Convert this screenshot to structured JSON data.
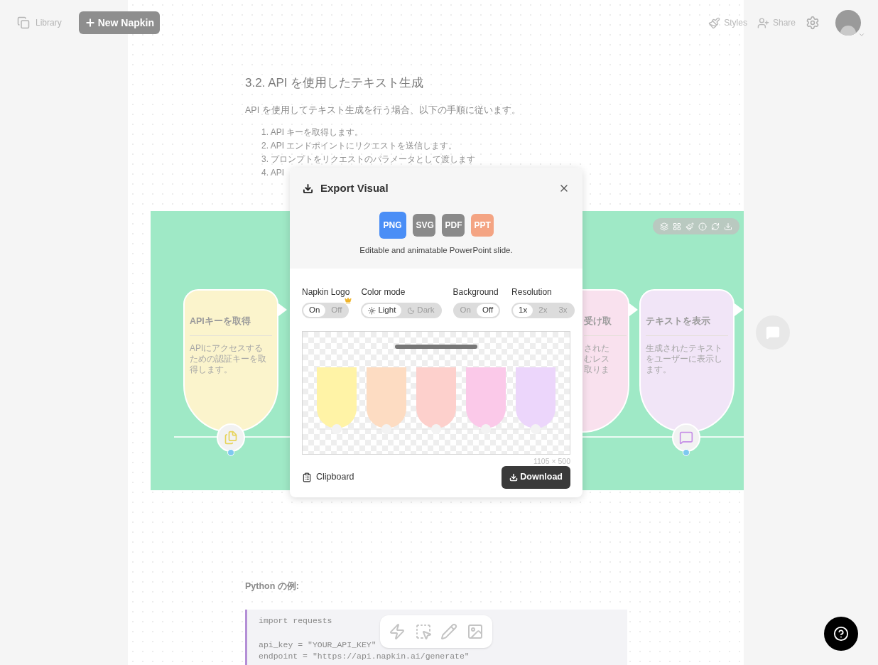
{
  "top_bar": {
    "library": "Library",
    "new_button": "New Napkin",
    "styles": "Styles",
    "share": "Share"
  },
  "document": {
    "heading": "3.2. API を使用したテキスト生成",
    "intro": "API を使用してテキスト生成を行う場合、以下の手順に従います。",
    "steps": [
      "1. API キーを取得します。",
      "2. API エンドポイントにリクエストを送信します。",
      "3. プロンプトをリクエストのパラメータとして渡します",
      "4. API"
    ],
    "code_label": "Python の例:",
    "code_blocks": [
      [
        "import requests"
      ],
      [
        "api_key = \"YOUR_API_KEY\"",
        "endpoint = \"https://api.napkin.ai/generate\""
      ]
    ]
  },
  "slide": {
    "cards": [
      {
        "kind": "full",
        "title": "APIキーを取得",
        "lines": [
          "APIにアクセスする",
          "ための認証キーを取",
          "得します。"
        ],
        "color": "#fbf4cc"
      },
      {
        "kind": "partial",
        "title": "受け取",
        "lines": [
          "された",
          "むレス",
          "取りま"
        ],
        "color": "#f9e1ee"
      },
      {
        "kind": "full",
        "title": "テキストを表示",
        "lines": [
          "生成されたテキスト",
          "をユーザーに表示し",
          "ます。"
        ],
        "color": "#f1e5f7"
      }
    ]
  },
  "export": {
    "title": "Export Visual",
    "formats": [
      {
        "label": "PNG",
        "selected": true,
        "color": "#4a8ef6"
      },
      {
        "label": "SVG",
        "selected": false,
        "color": "#8a8a8a"
      },
      {
        "label": "PDF",
        "selected": false,
        "color": "#8a8a8a"
      },
      {
        "label": "PPT",
        "selected": false,
        "color": "#f4a483"
      }
    ],
    "format_note": "Editable and animatable PowerPoint slide.",
    "options": [
      {
        "label": "Napkin Logo",
        "kind": "plain",
        "premium": true,
        "choices": [
          {
            "label": "On",
            "selected": true
          },
          {
            "label": "Off",
            "selected": false
          }
        ]
      },
      {
        "label": "Color mode",
        "kind": "theme",
        "choices": [
          {
            "label": "Light",
            "selected": true
          },
          {
            "label": "Dark",
            "selected": false
          }
        ]
      },
      {
        "label": "Background",
        "kind": "plain",
        "choices": [
          {
            "label": "On",
            "selected": false
          },
          {
            "label": "Off",
            "selected": true
          }
        ]
      },
      {
        "label": "Resolution",
        "kind": "plain",
        "choices": [
          {
            "label": "1x",
            "selected": true
          },
          {
            "label": "2x",
            "selected": false
          },
          {
            "label": "3x",
            "selected": false
          }
        ]
      }
    ],
    "size": "1105 × 500",
    "clipboard": "Clipboard",
    "download": "Download"
  }
}
